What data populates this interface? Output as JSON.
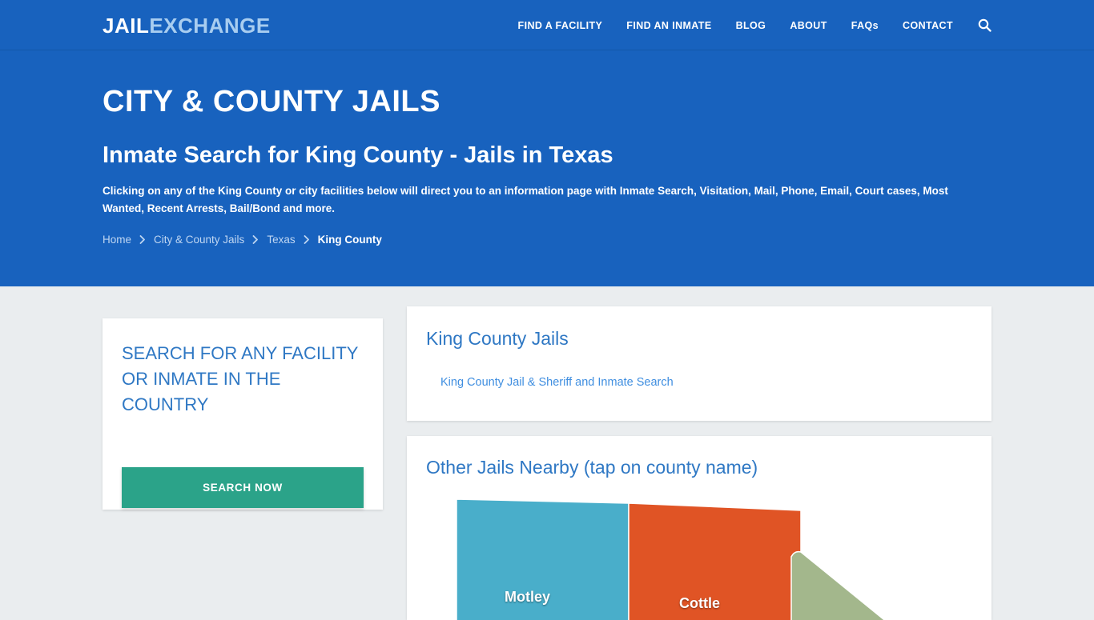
{
  "colors": {
    "brand_blue": "#1862be",
    "page_bg": "#eaedef",
    "link_blue": "#2f78c4",
    "teal_button": "#2ba389",
    "map_motley": "#49aeca",
    "map_cottle": "#e05425",
    "map_green": "#a3b78c"
  },
  "navbar": {
    "logo_primary": "JAIL",
    "logo_secondary": "EXCHANGE",
    "links": [
      {
        "label": "FIND A FACILITY"
      },
      {
        "label": "FIND AN INMATE"
      },
      {
        "label": "BLOG"
      },
      {
        "label": "ABOUT"
      },
      {
        "label": "FAQs"
      },
      {
        "label": "CONTACT"
      }
    ],
    "search_icon": "search-icon"
  },
  "hero": {
    "title": "CITY & COUNTY JAILS",
    "subtitle": "Inmate Search for King County - Jails in Texas",
    "description": "Clicking on any of the King County or city facilities below will direct you to an information page with Inmate Search, Visitation, Mail, Phone, Email, Court cases, Most Wanted, Recent Arrests, Bail/Bond and more.",
    "breadcrumb": [
      {
        "label": "Home",
        "current": false
      },
      {
        "label": "City & County Jails",
        "current": false
      },
      {
        "label": "Texas",
        "current": false
      },
      {
        "label": "King County",
        "current": true
      }
    ],
    "breadcrumb_separator": "chevron-right-icon"
  },
  "search_card": {
    "title": "Search for any facility or inmate in the country",
    "button_label": "SEARCH NOW"
  },
  "jails_card": {
    "title": "King County Jails",
    "links": [
      {
        "label": "King County Jail & Sheriff and Inmate Search"
      }
    ]
  },
  "nearby_card": {
    "title": "Other Jails Nearby (tap on county name)",
    "map_counties": [
      {
        "name": "Motley",
        "color": "#49aeca"
      },
      {
        "name": "Cottle",
        "color": "#e05425"
      }
    ]
  }
}
